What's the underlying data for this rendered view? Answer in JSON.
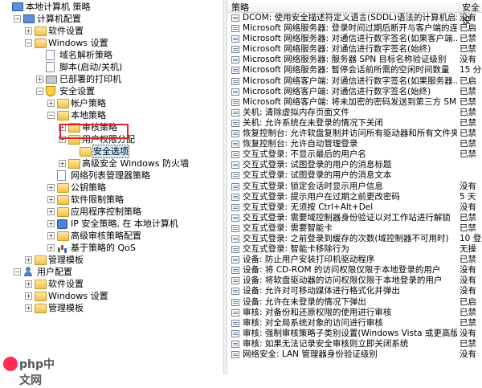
{
  "tree": {
    "items": [
      {
        "label": "本地计算机 策略",
        "icon": "computer"
      },
      {
        "label": "计算机配置",
        "icon": "computer"
      },
      {
        "label": "软件设置",
        "icon": "folder"
      },
      {
        "label": "Windows 设置",
        "icon": "folder"
      },
      {
        "label": "域名解析策略",
        "icon": "doc"
      },
      {
        "label": "脚本(启动/关机)",
        "icon": "doc"
      },
      {
        "label": "已部署的打印机",
        "icon": "printer"
      },
      {
        "label": "安全设置",
        "icon": "shield"
      },
      {
        "label": "帐户策略",
        "icon": "folder"
      },
      {
        "label": "本地策略",
        "icon": "folder"
      },
      {
        "label": "审核策略",
        "icon": "folder"
      },
      {
        "label": "用户权限分配",
        "icon": "folder"
      },
      {
        "label": "安全选项",
        "icon": "folder"
      },
      {
        "label": "高级安全 Windows 防火墙",
        "icon": "folder"
      },
      {
        "label": "网络列表管理器策略",
        "icon": "doc"
      },
      {
        "label": "公钥策略",
        "icon": "folder"
      },
      {
        "label": "软件限制策略",
        "icon": "folder"
      },
      {
        "label": "应用程序控制策略",
        "icon": "folder"
      },
      {
        "label": "IP 安全策略, 在 本地计算机",
        "icon": "network"
      },
      {
        "label": "高级审核策略配置",
        "icon": "folder"
      },
      {
        "label": "基于策略的 QoS",
        "icon": "chart"
      },
      {
        "label": "管理模板",
        "icon": "folder"
      },
      {
        "label": "用户配置",
        "icon": "user"
      },
      {
        "label": "软件设置",
        "icon": "folder"
      },
      {
        "label": "Windows 设置",
        "icon": "folder"
      },
      {
        "label": "管理模板",
        "icon": "folder"
      }
    ]
  },
  "table": {
    "col_policy": "策略",
    "col_setting": "安全设",
    "rows": [
      {
        "name": "DCOM: 使用安全描述符定义语言(SDDL)语法的计算机启动限制",
        "value": "没有"
      },
      {
        "name": "Microsoft 网络服务器: 登录时间过期后断开与客户端的连接",
        "value": "已启"
      },
      {
        "name": "Microsoft 网络服务器: 对通信进行数字签名(如果客户端...",
        "value": "已禁"
      },
      {
        "name": "Microsoft 网络服务器: 对通信进行数字签名(始终)",
        "value": "已禁"
      },
      {
        "name": "Microsoft 网络服务器: 服务器 SPN 目标名称验证级别",
        "value": "没有"
      },
      {
        "name": "Microsoft 网络服务器: 暂停会话前所需的空闲时间数量",
        "value": "15 分"
      },
      {
        "name": "Microsoft 网络客户端: 对通信进行数字签名(如果服务器...",
        "value": "已启"
      },
      {
        "name": "Microsoft 网络客户端: 对通信进行数字签名(始终)",
        "value": "已禁"
      },
      {
        "name": "Microsoft 网络客户端: 将未加密的密码发送到第三方 SM...",
        "value": "已禁"
      },
      {
        "name": "关机: 清除虚拟内存页面文件",
        "value": "已禁"
      },
      {
        "name": "关机: 允许系统在未登录的情况下关闭",
        "value": "已禁"
      },
      {
        "name": "恢复控制台: 允许软盘复制并访问所有驱动器和所有文件夹",
        "value": "已禁"
      },
      {
        "name": "恢复控制台: 允许自动管理登录",
        "value": "已禁"
      },
      {
        "name": "交互式登录: 不显示最后的用户名",
        "value": "已禁"
      },
      {
        "name": "交互式登录: 试图登录的用户的消息标题",
        "value": ""
      },
      {
        "name": "交互式登录: 试图登录的用户的消息文本",
        "value": ""
      },
      {
        "name": "交互式登录: 锁定会话时显示用户信息",
        "value": "没有"
      },
      {
        "name": "交互式登录: 提示用户在过期之前更改密码",
        "value": "5 天"
      },
      {
        "name": "交互式登录: 无须按 Ctrl+Alt+Del",
        "value": "没有"
      },
      {
        "name": "交互式登录: 需要域控制器身份验证以对工作站进行解锁",
        "value": "已禁"
      },
      {
        "name": "交互式登录: 需要智能卡",
        "value": "已禁"
      },
      {
        "name": "交互式登录: 之前登录到缓存的次数(域控制器不可用时)",
        "value": "10 登"
      },
      {
        "name": "交互式登录: 智能卡移除行为",
        "value": "无操"
      },
      {
        "name": "设备: 防止用户安装打印机驱动程序",
        "value": "已禁"
      },
      {
        "name": "设备: 将 CD-ROM 的访问权限仅限于本地登录的用户",
        "value": "没有"
      },
      {
        "name": "设备: 将软盘驱动器的访问权限仅限于本地登录的用户",
        "value": "没有"
      },
      {
        "name": "设备: 允许对可移动媒体进行格式化并弹出",
        "value": "没有"
      },
      {
        "name": "设备: 允许在未登录的情况下弹出",
        "value": "已启"
      },
      {
        "name": "审核: 对备份和还原权限的使用进行审核",
        "value": "已禁"
      },
      {
        "name": "审核: 对全局系统对象的访问进行审核",
        "value": "已禁"
      },
      {
        "name": "审核: 强制审核策略子类别设置(Windows Vista 或更高版...",
        "value": "没有"
      },
      {
        "name": "审核: 如果无法记录安全审核则立即关闭系统",
        "value": "已禁"
      },
      {
        "name": "网络安全: LAN 管理器身份验证级别",
        "value": "没有"
      }
    ]
  },
  "watermark": {
    "text": "php中文网"
  },
  "colors": {
    "highlight": "#e0242b",
    "selection": "#cce8ff"
  }
}
